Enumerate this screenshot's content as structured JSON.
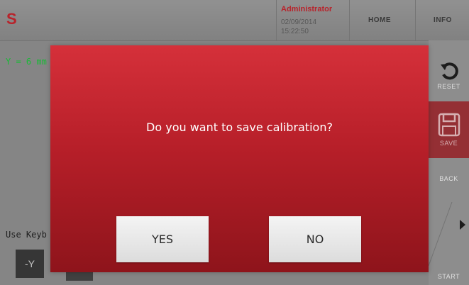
{
  "header": {
    "logo": "S",
    "user": {
      "name": "Administrator",
      "date": "02/09/2014",
      "time": "15:22:50"
    },
    "nav": {
      "home": "HOME",
      "info": "INFO"
    }
  },
  "main": {
    "readout": "Y = 6 mm",
    "hint": "Use Keyb",
    "jog_button": "-Y"
  },
  "side_panel": {
    "reset": {
      "label": "RESET",
      "icon": "rotate-ccw-icon"
    },
    "save": {
      "label": "SAVE",
      "icon": "floppy-disk-icon"
    },
    "back": {
      "label": "BACK"
    },
    "start": {
      "label": "START"
    }
  },
  "dialog": {
    "message": "Do you want to save calibration?",
    "yes_label": "YES",
    "no_label": "NO"
  },
  "colors": {
    "brand_red": "#c4262e",
    "dialog_top": "#d5303a",
    "dialog_bottom": "#8e141b",
    "readout_green": "#1ec43c"
  }
}
